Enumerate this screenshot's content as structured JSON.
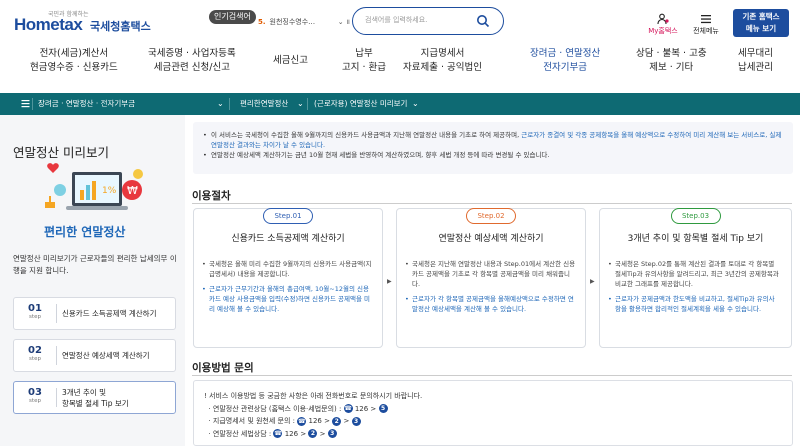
{
  "header": {
    "logo_tagline": "국민과 함께하는",
    "logo_text": "Hometax",
    "logo_kr": "국세청홈택스",
    "popular_label": "인기검색어",
    "popular_rank": "5.",
    "popular_term": "원천징수영수…",
    "search_placeholder": "검색어를 입력하세요.",
    "my_label": "My홈택스",
    "menu_label": "전체메뉴",
    "site_button_line1": "기존 홈택스",
    "site_button_line2": "메뉴 보기"
  },
  "gnb": [
    {
      "line1": "전자(세금)계산서",
      "line2": "현금영수증 · 신용카드"
    },
    {
      "line1": "국세증명 · 사업자등록",
      "line2": "세금관련 신청/신고"
    },
    {
      "line1": "세금신고",
      "line2": ""
    },
    {
      "line1": "납부",
      "line2": "고지 · 환급"
    },
    {
      "line1": "지급명세서",
      "line2": "자료제출 · 공익법인"
    },
    {
      "line1": "장려금 · 연말정산",
      "line2": "전자기부금"
    },
    {
      "line1": "상담 · 불복 · 고충",
      "line2": "제보 · 기타"
    },
    {
      "line1": "세무대리",
      "line2": "납세관리"
    }
  ],
  "breadcrumb": {
    "item1": "장려금 · 연말정산 · 전자기부금",
    "item2": "편리한연말정산",
    "item3": "(근로자용) 연말정산 미리보기"
  },
  "left": {
    "title": "연말정산 미리보기",
    "subtitle": "편리한 연말정산",
    "description": "연말정산 미리보기가 근로자들의 편리한 납세의무 이행을 지원 합니다.",
    "steps": [
      {
        "num": "01",
        "step": "step",
        "text1": "신용카드 소득공제액 계산하기",
        "text2": ""
      },
      {
        "num": "02",
        "step": "step",
        "text1": "연말정산 예상세액 계산하기",
        "text2": ""
      },
      {
        "num": "03",
        "step": "step",
        "text1": "3개년 추이 및",
        "text2": "항목별 절세 Tip 보기"
      }
    ]
  },
  "notice": {
    "p1_a": "이 서비스는 국세청이 수집한 올해 9월까지의 신용카드 사용금액과 지난해 연말정산 내용을 기초로 하여 제공하며,",
    "p1_b": "근로자가 종결여 및 각종 공제항목을 올해 예상액으로 수정하여 미리 계산해 보는 서비스로, 실제 연말정산 결과와는 차이가 날 수 있습니다.",
    "p2": "연말정산 예상세액 계산하기는 금년 10월 현재 세법을 반영하여 계산하였으며, 향후 세법 개정 등에 따라 변경될 수 있습니다."
  },
  "procedure": {
    "title": "이용절차",
    "cards": [
      {
        "step": "Step.01",
        "color": "#2f5fb3",
        "title": "신용카드 소득공제액 계산하기",
        "p1": "국세청은 올해 미리 수집한 9월까지의 신용카드 사용금액(지급명세서) 내용을 제공합니다.",
        "p2": "근로자가 근무기간과 올해의 총급여액, 10월~12월의 신용카드 예상 사용금액을 입력(수정)하면 신용카드 공제액을 미리 예상해 볼 수 있습니다."
      },
      {
        "step": "Step.02",
        "color": "#e06a2e",
        "title": "연말정산 예상세액 계산하기",
        "p1": "국세청은 지난해 연말정산 내용과 Step.01에서 계산한 신용카드 공제액을 기초로 각 항목별 공제금액을 미리 채워줍니다.",
        "p2": "근로자가 각 항목별 공제금액을 올해예상액으로 수정하면 연말정산 예상세액을 계산해 볼 수 있습니다."
      },
      {
        "step": "Step.03",
        "color": "#2f9a3f",
        "title": "3개년 추이 및 항목별 절세 Tip 보기",
        "p1": "국세청은 Step.02를 통해 계산된 결과를 토대로 각 항목별 절세Tip과 유의사항을 알려드리고, 최근 3년간의 공제항목과 비교한 그래프를 제공합니다.",
        "p2": "근로자가 공제금액과 한도액을 비교하고, 절세Tip과 유의사항을 활용하면 합리적인 절세계획을 세울 수 있습니다."
      }
    ]
  },
  "inquiry": {
    "title": "이용방법 문의",
    "intro": "! 서비스 이용방법 등 궁금한 사항은 아래 전화번호로 문의하시기 바랍니다.",
    "lines": [
      {
        "label": "· 연말정산 관련상담 (홈택스 이용·세법문의) :",
        "a": "126",
        "b": "5",
        "c": ""
      },
      {
        "label": "· 지급명세서 및 원천세 문의 :",
        "a": "126",
        "b": "2",
        "c": "3"
      },
      {
        "label": "· 연말정산 세법상담 :",
        "a": "126",
        "b": "2",
        "c": "3"
      }
    ]
  }
}
